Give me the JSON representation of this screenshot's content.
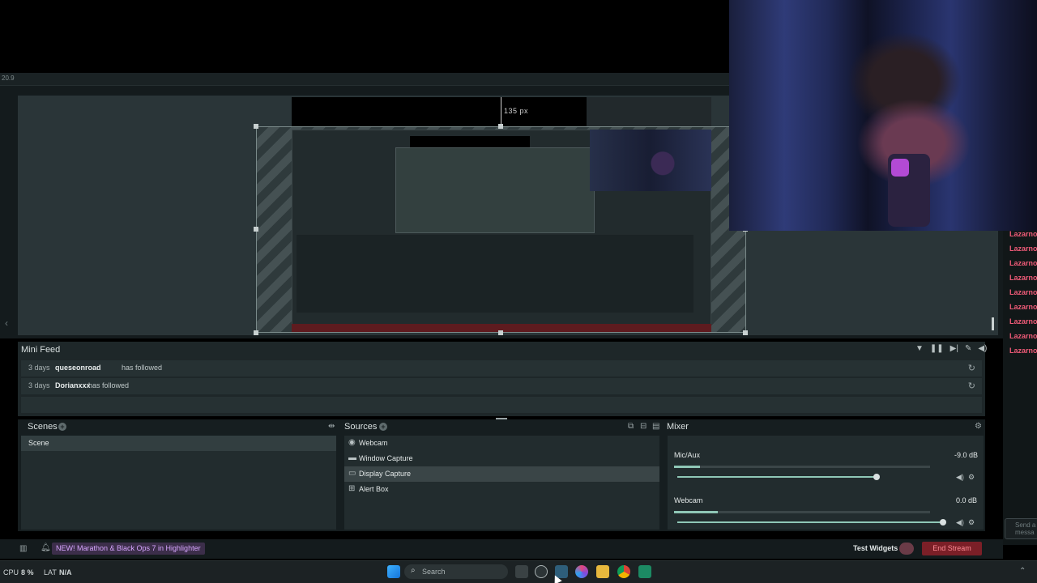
{
  "editor": {
    "fps_label": "20.9",
    "guide_label": "135 px"
  },
  "chat": {
    "names": [
      "Lazarnow",
      "Lazarnow",
      "Lazarnow",
      "Lazarnow",
      "Lazarnow",
      "Lazarnow",
      "Lazarnow",
      "Lazarnow",
      "Lazarnow"
    ],
    "send_placeholder_line1": "Send a",
    "send_placeholder_line2": "messa"
  },
  "minifeed": {
    "title": "Mini Feed",
    "items": [
      {
        "days": "3 days",
        "user": "queseonroad",
        "action": "has followed"
      },
      {
        "days": "3 days",
        "user": "Dorianxxx",
        "action": "has followed"
      }
    ]
  },
  "scenes": {
    "title": "Scenes",
    "items": [
      "Scene"
    ]
  },
  "sources": {
    "title": "Sources",
    "items": [
      {
        "label": "Webcam",
        "icon": "camera-icon",
        "selected": false
      },
      {
        "label": "Window Capture",
        "icon": "window-icon",
        "selected": false
      },
      {
        "label": "Display Capture",
        "icon": "monitor-icon",
        "selected": true
      },
      {
        "label": "Alert Box",
        "icon": "alert-icon",
        "selected": false
      }
    ]
  },
  "mixer": {
    "title": "Mixer",
    "channels": [
      {
        "name": "Mic/Aux",
        "db": "-9.0 dB",
        "level": 0.1,
        "volume": 0.75
      },
      {
        "name": "Webcam",
        "db": "0.0 dB",
        "level": 0.17,
        "volume": 1.0
      }
    ]
  },
  "bottom": {
    "highlight": "NEW! Marathon & Black Ops 7 in Highlighter",
    "test_widgets": "Test Widgets",
    "end_stream": "End Stream"
  },
  "taskbar": {
    "cpu_label": "CPU",
    "cpu_value": "8 %",
    "lat_label": "LAT",
    "lat_value": "N/A",
    "search": "Search"
  },
  "colors": {
    "accent": "#8fc7b6",
    "end_stream": "#7b1f27",
    "chat_name": "#f05b78"
  }
}
